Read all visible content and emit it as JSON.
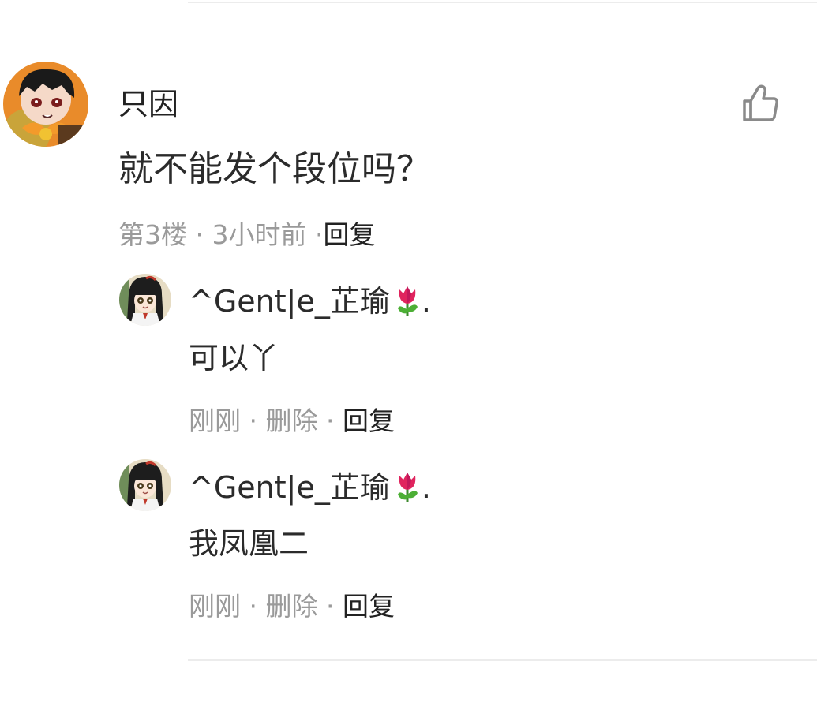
{
  "comment": {
    "username": "只因",
    "text": "就不能发个段位吗？",
    "floor": "第3楼",
    "sep1": " · ",
    "time": "3小时前",
    "sep2": " ·",
    "reply_label": "回复",
    "avatar_icon": "user-avatar-icon",
    "like_icon": "thumbs-up-icon"
  },
  "replies": [
    {
      "username": "^Gent|e_芷瑜",
      "suffix": ".",
      "emoji_icon": "tulip-icon",
      "text": "可以丫",
      "time": "刚刚",
      "sep1": " · ",
      "delete_label": "删除",
      "sep2": " · ",
      "reply_label": "回复"
    },
    {
      "username": "^Gent|e_芷瑜",
      "suffix": ".",
      "emoji_icon": "tulip-icon",
      "text": "我凤凰二",
      "time": "刚刚",
      "sep1": " · ",
      "delete_label": "删除",
      "sep2": " · ",
      "reply_label": "回复"
    }
  ],
  "colors": {
    "primary_text": "#222222",
    "secondary_text": "#9a9a9a",
    "divider": "#ececec"
  }
}
